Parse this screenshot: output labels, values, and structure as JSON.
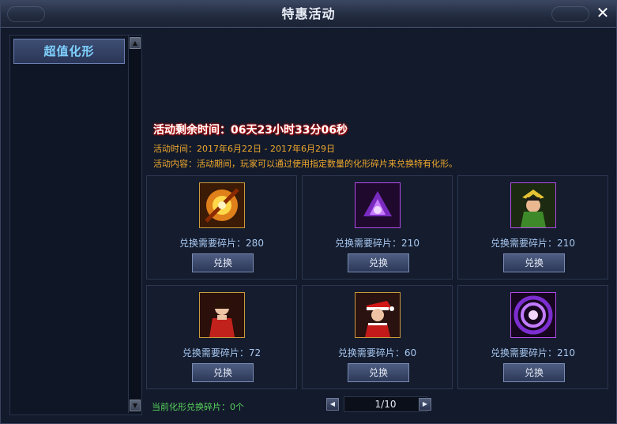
{
  "window": {
    "title": "特惠活动",
    "close_icon": "close-icon"
  },
  "sidebar": {
    "tab_label": "超值化形"
  },
  "activity": {
    "countdown": "活动剩余时间：06天23小时33分06秒",
    "time": "活动时间：2017年6月22日 - 2017年6月29日",
    "desc": "活动内容：活动期间，玩家可以通过使用指定数量的化形碎片来兑换特有化形。"
  },
  "items": [
    {
      "icon": "flaming-wheel-icon",
      "need": "兑换需要碎片：280",
      "button": "兑换"
    },
    {
      "icon": "purple-demon-icon",
      "need": "兑换需要碎片：210",
      "button": "兑换"
    },
    {
      "icon": "golden-warrior-icon",
      "need": "兑换需要碎片：210",
      "button": "兑换"
    },
    {
      "icon": "red-dress-girl-icon",
      "need": "兑换需要碎片：72",
      "button": "兑换"
    },
    {
      "icon": "christmas-girl-icon",
      "need": "兑换需要碎片：60",
      "button": "兑换"
    },
    {
      "icon": "purple-vortex-icon",
      "need": "兑换需要碎片：210",
      "button": "兑换"
    }
  ],
  "footer": {
    "current_fragments": "当前化形兑换碎片：0个",
    "page": "1/10"
  },
  "colors": {
    "accent": "#7fd2ff",
    "warning": "#f0a92e",
    "success": "#58d35b"
  }
}
